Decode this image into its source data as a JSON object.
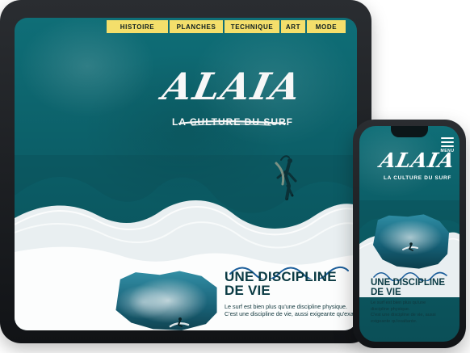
{
  "tablet": {
    "nav": {
      "items": [
        {
          "label": "HISTOIRE"
        },
        {
          "label": "PLANCHES"
        },
        {
          "label": "TECHNIQUE"
        },
        {
          "label": "ART"
        },
        {
          "label": "MODE"
        }
      ]
    },
    "hero": {
      "title": "ALAIA",
      "subtitle": "LA CULTURE DU SURF"
    },
    "section": {
      "title": "UNE DISCIPLINE\nDE VIE",
      "body": "Le surf est bien plus qu'une discipline physique.\nC'est une discipline de vie, aussi exigeante qu'exalta"
    }
  },
  "phone": {
    "menu_label": "MENU",
    "hero": {
      "title": "ALAIA",
      "subtitle": "LA CULTURE DU SURF"
    },
    "section": {
      "title": "UNE DISCIPLINE\nDE VIE",
      "body": "Le surf est bien plus qu'une\ndiscipline physique.\nC'est une discipline de vie, aussi\nexigeante qu'exaltante."
    }
  }
}
